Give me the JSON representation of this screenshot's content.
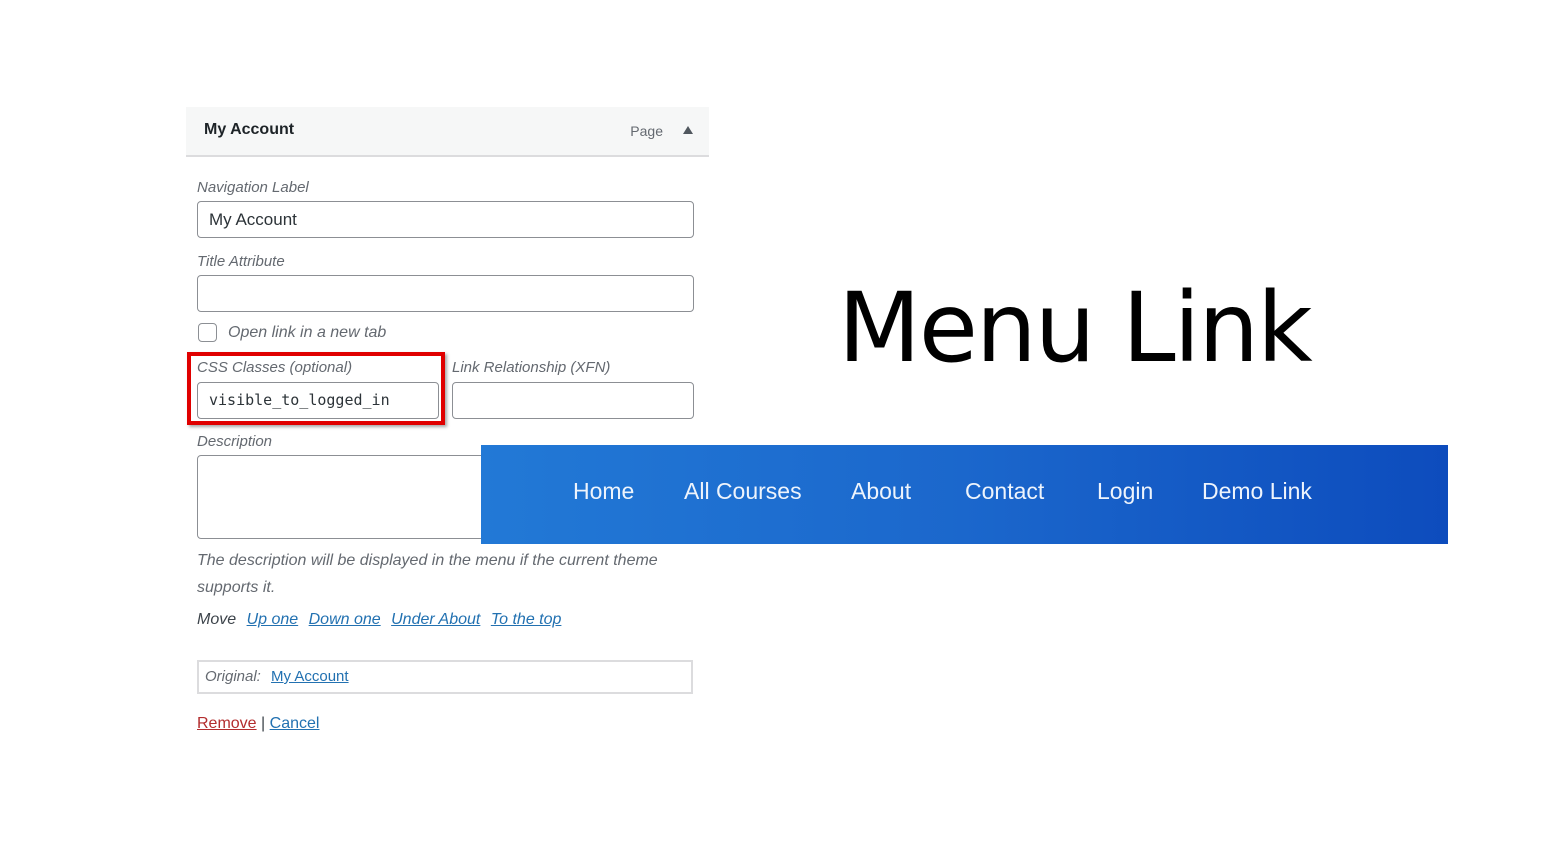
{
  "panel": {
    "title": "My Account",
    "type": "Page",
    "toggle_icon": "triangle-up-icon"
  },
  "fields": {
    "navigation_label": {
      "label": "Navigation Label",
      "value": "My Account"
    },
    "title_attribute": {
      "label": "Title Attribute",
      "value": ""
    },
    "open_new_tab": {
      "label": "Open link in a new tab",
      "checked": false
    },
    "css_classes": {
      "label": "CSS Classes (optional)",
      "value": "visible_to_logged_in"
    },
    "link_relationship": {
      "label": "Link Relationship (XFN)",
      "value": ""
    },
    "description": {
      "label": "Description",
      "value": ""
    }
  },
  "help_text": {
    "line1": "The description will be displayed in the menu if the current theme",
    "line2": "supports it."
  },
  "move": {
    "label": "Move",
    "links": [
      "Up one",
      "Down one",
      "Under About",
      "To the top"
    ]
  },
  "original": {
    "label": "Original:",
    "link": "My Account"
  },
  "actions": {
    "remove": "Remove",
    "separator": "|",
    "cancel": "Cancel"
  },
  "heading": "Menu Link",
  "navbar": {
    "items": [
      "Home",
      "All Courses",
      "About",
      "Contact",
      "Login",
      "Demo Link"
    ]
  },
  "colors": {
    "highlight": "#e00000",
    "link": "#2271b1",
    "remove": "#b32d2e",
    "navbar_start": "#2279d6",
    "navbar_end": "#0d4cbd"
  }
}
